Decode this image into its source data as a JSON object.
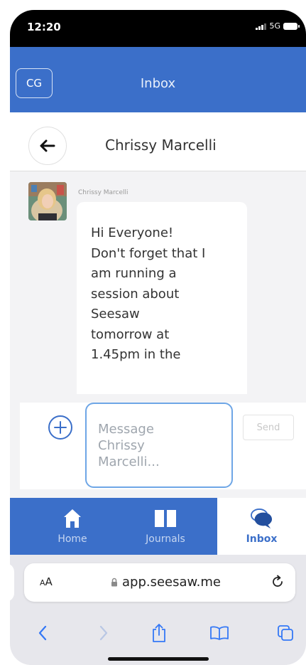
{
  "status_bar": {
    "time": "12:20",
    "network": "5G"
  },
  "header": {
    "initials": "CG",
    "title": "Inbox"
  },
  "conversation": {
    "name": "Chrissy Marcelli"
  },
  "message": {
    "sender": "Chrissy Marcelli",
    "lines": [
      "Hi Everyone!",
      "Don't forget that I",
      "am running a",
      "session about",
      "Seesaw",
      "tomorrow at",
      "1.45pm in the"
    ]
  },
  "compose": {
    "placeholder_lines": [
      "Message",
      "Chrissy",
      "Marcelli..."
    ],
    "send_label": "Send"
  },
  "tabs": [
    {
      "label": "Home",
      "icon": "home-icon"
    },
    {
      "label": "Journals",
      "icon": "book-icon"
    },
    {
      "label": "Inbox",
      "icon": "chat-bubbles-icon",
      "active": true
    }
  ],
  "browser": {
    "text_size_label": "AA",
    "url": "app.seesaw.me"
  },
  "colors": {
    "brand_blue": "#3b6fc9",
    "input_border": "#6ea6e6"
  }
}
